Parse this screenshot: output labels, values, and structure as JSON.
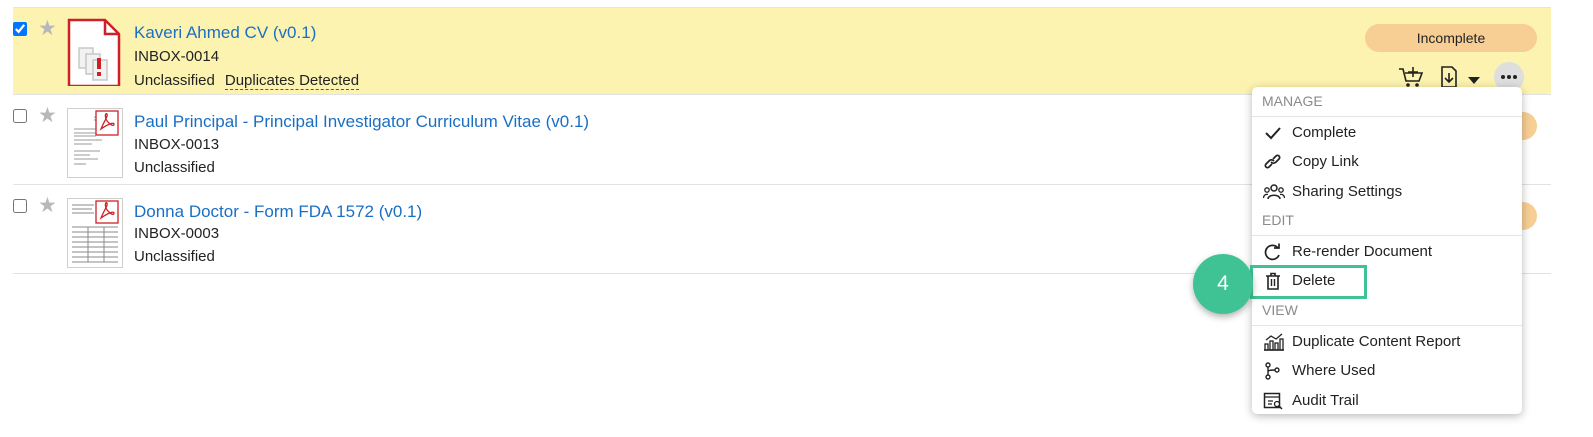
{
  "documents": [
    {
      "title": "Kaveri Ahmed CV (v0.1)",
      "doc_number": "INBOX-0014",
      "classification": "Unclassified",
      "duplicate_note": "Duplicates Detected",
      "status": "Incomplete",
      "checked": true,
      "selected": true,
      "thumbnail": "document-warning-icon"
    },
    {
      "title": "Paul Principal - Principal Investigator Curriculum Vitae (v0.1)",
      "doc_number": "INBOX-0013",
      "classification": "Unclassified",
      "checked": false,
      "thumbnail": "pdf-thumbnail"
    },
    {
      "title": "Donna Doctor - Form FDA 1572 (v0.1)",
      "doc_number": "INBOX-0003",
      "classification": "Unclassified",
      "checked": false,
      "thumbnail": "pdf-thumbnail"
    }
  ],
  "row_actions": {
    "icons": [
      "add-to-cart-icon",
      "download-icon",
      "caret-down-icon",
      "more-options-icon"
    ]
  },
  "menu": {
    "sections": [
      {
        "heading": "MANAGE",
        "items": [
          {
            "label": "Complete",
            "icon": "checkmark-icon"
          },
          {
            "label": "Copy Link",
            "icon": "link-icon"
          },
          {
            "label": "Sharing Settings",
            "icon": "users-icon"
          }
        ]
      },
      {
        "heading": "EDIT",
        "items": [
          {
            "label": "Re-render Document",
            "icon": "refresh-icon"
          },
          {
            "label": "Delete",
            "icon": "trash-icon"
          }
        ]
      },
      {
        "heading": "VIEW",
        "items": [
          {
            "label": "Duplicate Content Report",
            "icon": "chart-icon"
          },
          {
            "label": "Where Used",
            "icon": "branch-icon"
          },
          {
            "label": "Audit Trail",
            "icon": "audit-icon"
          }
        ]
      }
    ]
  },
  "step_badge": "4",
  "colors": {
    "link": "#1a6fc4",
    "selected_row": "#fdf3b0",
    "status_badge": "#f7cf95",
    "highlight": "#3fc394"
  }
}
